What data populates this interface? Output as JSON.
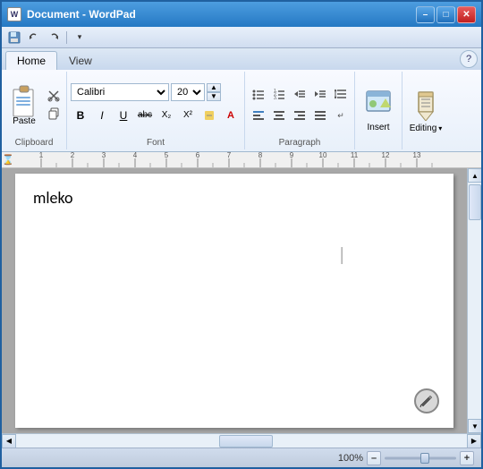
{
  "window": {
    "title": "Document - WordPad",
    "minimize": "–",
    "maximize": "□",
    "close": "✕"
  },
  "quickaccess": {
    "save_label": "💾",
    "undo_label": "↩",
    "redo_label": "↪",
    "dropdown_label": "▾"
  },
  "tabs": {
    "home": "Home",
    "view": "View",
    "help_icon": "?"
  },
  "ribbon": {
    "clipboard_label": "Clipboard",
    "paste_label": "Paste",
    "cut_label": "✂",
    "copy_label": "⿻",
    "font_label": "Font",
    "font_name": "Calibri",
    "font_size": "20",
    "bold": "B",
    "italic": "I",
    "underline": "U",
    "strikethrough": "abc",
    "subscript": "X₂",
    "superscript": "X²",
    "highlight": "🖊",
    "font_color": "A",
    "paragraph_label": "Paragraph",
    "align_left": "≡",
    "align_center": "≡",
    "align_right": "≡",
    "justify": "≡",
    "line_spacing": "↕",
    "bullets": "≔",
    "numbering": "≔",
    "indent_dec": "⇤",
    "indent_inc": "⇥",
    "insert_label": "Insert",
    "insert_icon": "🖼",
    "editing_label": "Editing",
    "editing_icon": "✏"
  },
  "ruler": {
    "hourglass": "⌛",
    "ticks": [
      1,
      2,
      3,
      4,
      5,
      6,
      7,
      8,
      9,
      10,
      11,
      12,
      13
    ]
  },
  "document": {
    "content": "mleko"
  },
  "statusbar": {
    "zoom_percent": "100%",
    "zoom_minus": "–",
    "zoom_plus": "+"
  }
}
